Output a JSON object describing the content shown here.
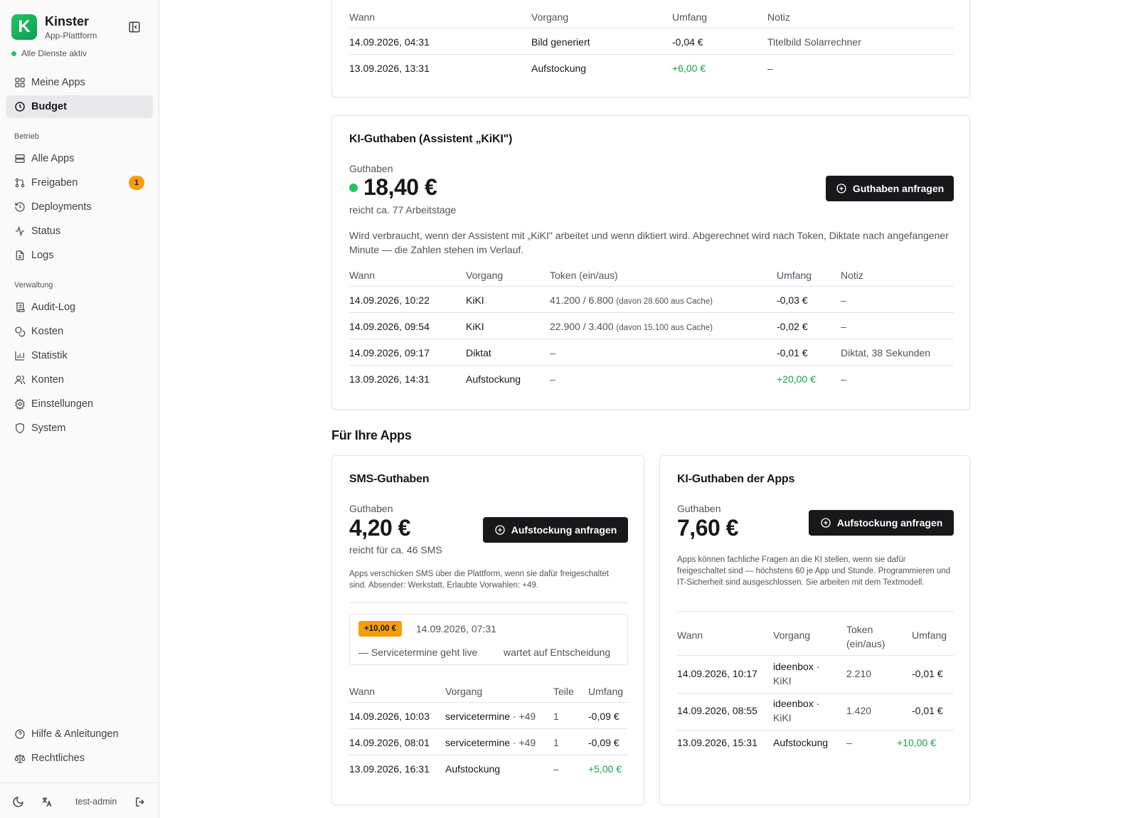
{
  "sidebar": {
    "app_name": "Kinster",
    "app_subtitle": "App-Plattform",
    "logo_letter": "K",
    "service_status": "Alle Dienste aktiv",
    "items_top": [
      {
        "label": "Meine Apps",
        "icon": "grid-icon"
      },
      {
        "label": "Budget",
        "icon": "clock-icon",
        "active": true
      }
    ],
    "section_betrieb": "Betrieb",
    "items_betrieb": [
      {
        "label": "Alle Apps",
        "icon": "server-icon"
      },
      {
        "label": "Freigaben",
        "icon": "git-pull-request-icon",
        "badge": "1"
      },
      {
        "label": "Deployments",
        "icon": "history-icon"
      },
      {
        "label": "Status",
        "icon": "activity-icon"
      },
      {
        "label": "Logs",
        "icon": "file-text-icon"
      }
    ],
    "section_verwaltung": "Verwaltung",
    "items_verwaltung": [
      {
        "label": "Audit-Log",
        "icon": "scroll-icon"
      },
      {
        "label": "Kosten",
        "icon": "coins-icon"
      },
      {
        "label": "Statistik",
        "icon": "bar-chart-icon"
      },
      {
        "label": "Konten",
        "icon": "users-icon"
      },
      {
        "label": "Einstellungen",
        "icon": "gear-icon"
      },
      {
        "label": "System",
        "icon": "shield-icon"
      }
    ],
    "items_bottom": [
      {
        "label": "Hilfe & Anleitungen",
        "icon": "help-circle-icon"
      },
      {
        "label": "Rechtliches",
        "icon": "scale-icon"
      }
    ],
    "username": "test-admin"
  },
  "top_table": {
    "headers": [
      "Wann",
      "Vorgang",
      "Umfang",
      "Notiz"
    ],
    "rows": [
      {
        "wann": "14.09.2026, 04:31",
        "vorgang": "Bild generiert",
        "umfang": "-0,04 €",
        "notiz": "Titelbild Solarrechner"
      },
      {
        "wann": "13.09.2026, 13:31",
        "vorgang": "Aufstockung",
        "umfang": "+6,00 €",
        "notiz": "–"
      }
    ]
  },
  "ki_card": {
    "title": "KI-Guthaben (Assistent „KiKI\")",
    "balance_label": "Guthaben",
    "balance": "18,40 €",
    "status_color": "#22c55e",
    "reach": "reicht ca. 77 Arbeitstage",
    "button": "Guthaben anfragen",
    "description": "Wird verbraucht, wenn der Assistent mit „KiKI\" arbeitet und wenn diktiert wird. Abgerechnet wird nach Token, Diktate nach angefangener Minute — die Zahlen stehen im Verlauf.",
    "headers": [
      "Wann",
      "Vorgang",
      "Token (ein/aus)",
      "Umfang",
      "Notiz"
    ],
    "rows": [
      {
        "wann": "14.09.2026, 10:22",
        "vorgang": "KiKI",
        "token": "41.200 / 6.800",
        "cache": "(davon 28.600 aus Cache)",
        "umfang": "-0,03 €",
        "notiz": "–"
      },
      {
        "wann": "14.09.2026, 09:54",
        "vorgang": "KiKI",
        "token": "22.900 / 3.400",
        "cache": "(davon 15.100 aus Cache)",
        "umfang": "-0,02 €",
        "notiz": "–"
      },
      {
        "wann": "14.09.2026, 09:17",
        "vorgang": "Diktat",
        "token": "–",
        "cache": "",
        "umfang": "-0,01 €",
        "notiz": "Diktat, 38 Sekunden"
      },
      {
        "wann": "13.09.2026, 14:31",
        "vorgang": "Aufstockung",
        "token": "–",
        "cache": "",
        "umfang": "+20,00 €",
        "notiz": "–"
      }
    ]
  },
  "apps_section_title": "Für Ihre Apps",
  "sms_card": {
    "title": "SMS-Guthaben",
    "balance_label": "Guthaben",
    "balance": "4,20 €",
    "reach": "reicht für ca. 46 SMS",
    "button": "Aufstockung anfragen",
    "description": "Apps verschicken SMS über die Plattform, wenn sie dafür freigeschaltet sind. Absender: Werkstatt. Erlaubte Vorwahlen: +49.",
    "pending": {
      "amount": "+10,00 €",
      "date": "14.09.2026, 07:31",
      "note": "— Servicetermine geht live",
      "state": "wartet auf Entscheidung"
    },
    "headers": [
      "Wann",
      "Vorgang",
      "Teile",
      "Umfang"
    ],
    "rows": [
      {
        "wann": "14.09.2026, 10:03",
        "vorgang": "servicetermine",
        "prefix": "· +49",
        "teile": "1",
        "umfang": "-0,09 €"
      },
      {
        "wann": "14.09.2026, 08:01",
        "vorgang": "servicetermine",
        "prefix": "· +49",
        "teile": "1",
        "umfang": "-0,09 €"
      },
      {
        "wann": "13.09.2026, 16:31",
        "vorgang": "Aufstockung",
        "prefix": "",
        "teile": "–",
        "umfang": "+5,00 €"
      }
    ]
  },
  "app_ki_card": {
    "title": "KI-Guthaben der Apps",
    "balance_label": "Guthaben",
    "balance": "7,60 €",
    "button": "Aufstockung anfragen",
    "description": "Apps können fachliche Fragen an die KI stellen, wenn sie dafür freigeschaltet sind — höchstens 60 je App und Stunde. Programmieren und IT-Sicherheit sind ausgeschlossen. Sie arbeiten mit dem Textmodell.",
    "headers": [
      "Wann",
      "Vorgang",
      "Token (ein/aus)",
      "Umfang"
    ],
    "rows": [
      {
        "wann": "14.09.2026, 10:17",
        "vorgang": "ideenbox ·",
        "vorgang2": "KiKI",
        "token": "2.210",
        "umfang": "-0,01 €"
      },
      {
        "wann": "14.09.2026, 08:55",
        "vorgang": "ideenbox ·",
        "vorgang2": "KiKI",
        "token": "1.420",
        "umfang": "-0,01 €"
      },
      {
        "wann": "13.09.2026, 15:31",
        "vorgang": "Aufstockung",
        "vorgang2": "",
        "token": "–",
        "umfang": "+10,00 €"
      }
    ]
  },
  "colors": {
    "positive": "#16a34a",
    "pending": "#f59e0b",
    "button": "#18181b"
  }
}
